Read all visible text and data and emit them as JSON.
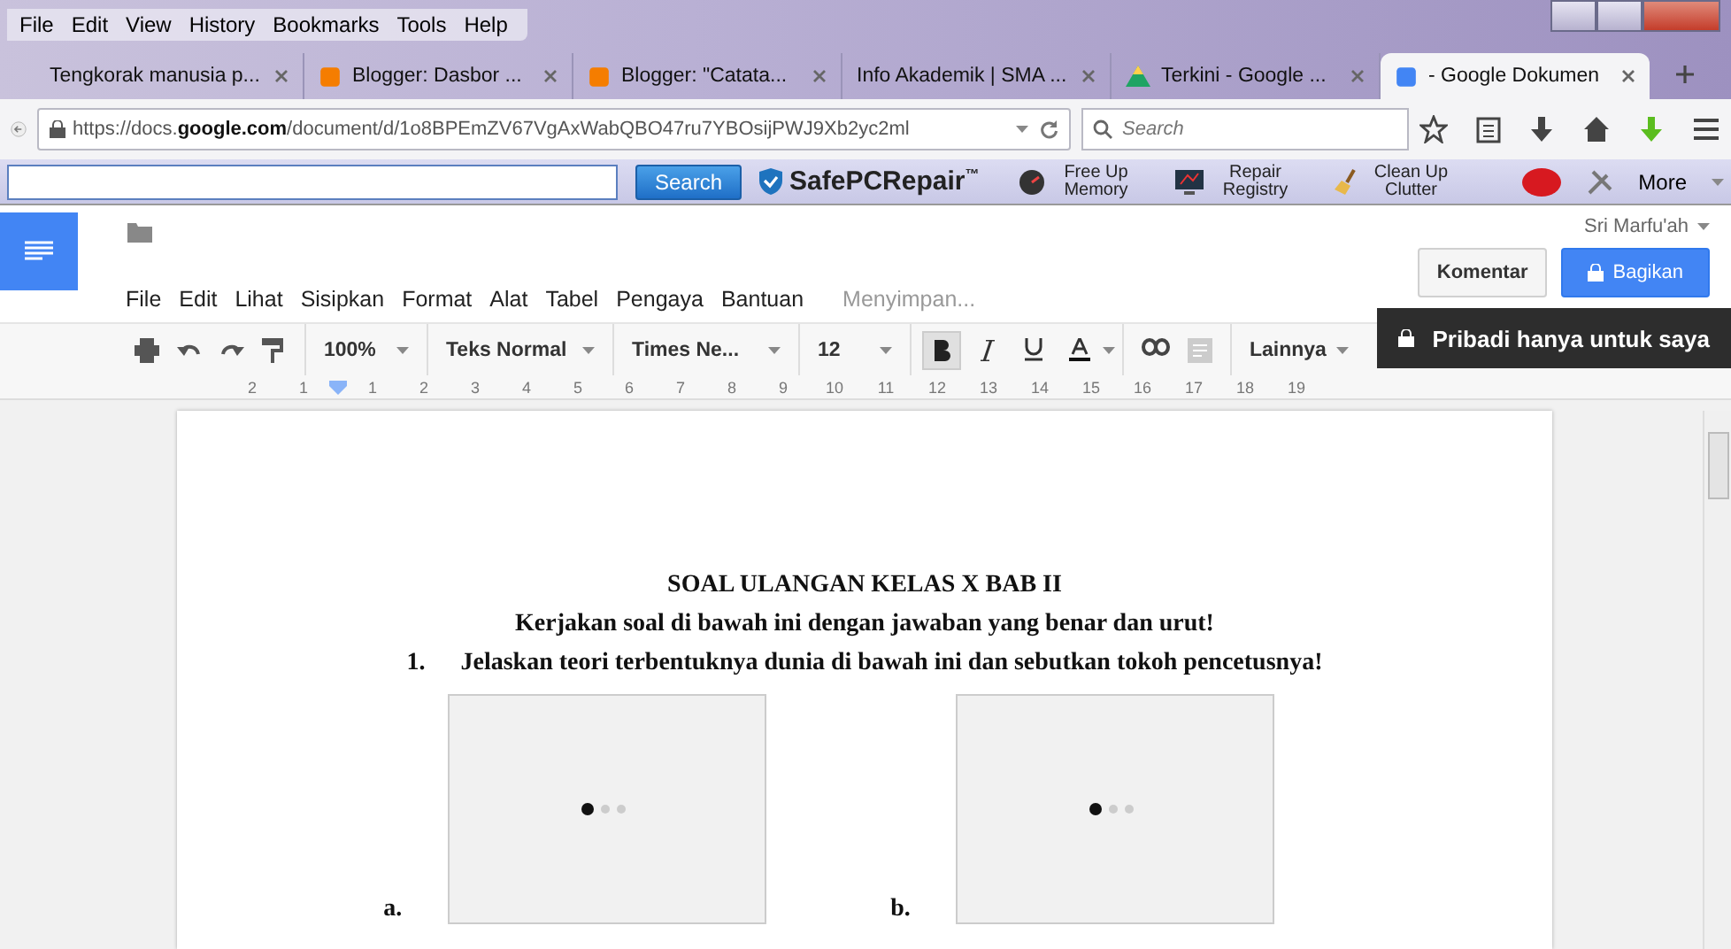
{
  "browser_menu": [
    "File",
    "Edit",
    "View",
    "History",
    "Bookmarks",
    "Tools",
    "Help"
  ],
  "tabs": [
    {
      "label": "Tengkorak manusia p...",
      "kind": "plain",
      "selected": false
    },
    {
      "label": "Blogger: Dasbor ...",
      "kind": "blogger",
      "selected": false
    },
    {
      "label": "Blogger: \"Catata...",
      "kind": "blogger",
      "selected": false
    },
    {
      "label": "Info Akademik | SMA ...",
      "kind": "plain",
      "selected": false
    },
    {
      "label": "Terkini - Google ...",
      "kind": "drive",
      "selected": false
    },
    {
      "label": "- Google Dokumen",
      "kind": "docs",
      "selected": true
    }
  ],
  "address": {
    "prefix": "https://docs.",
    "domain": "google.com",
    "path": "/document/d/1o8BPEmZV67VgAxWabQBO47ru7YBOsijPWJ9Xb2yc2ml"
  },
  "search": {
    "placeholder": "Search"
  },
  "addon_bar": {
    "search_button": "Search",
    "brand": "SafePCRepair",
    "brand_tm": "™",
    "items": [
      {
        "kind": "memory",
        "label": "Free Up Memory"
      },
      {
        "kind": "registry",
        "label": "Repair Registry"
      },
      {
        "kind": "clutter",
        "label": "Clean Up Clutter"
      }
    ],
    "more": "More"
  },
  "docs": {
    "user": "Sri Marfu'ah",
    "menu": [
      "File",
      "Edit",
      "Lihat",
      "Sisipkan",
      "Format",
      "Alat",
      "Tabel",
      "Pengaya",
      "Bantuan"
    ],
    "status": "Menyimpan...",
    "comment_button": "Komentar",
    "share_button": "Bagikan"
  },
  "toolbar": {
    "zoom": "100%",
    "style": "Teks Normal",
    "font": "Times Ne...",
    "size": "12",
    "bold": true,
    "more": "Lainnya"
  },
  "tooltip": "Pribadi hanya untuk saya",
  "ruler": [
    "2",
    "1",
    "1",
    "2",
    "3",
    "4",
    "5",
    "6",
    "7",
    "8",
    "9",
    "10",
    "11",
    "12",
    "13",
    "14",
    "15",
    "16",
    "17",
    "18",
    "19"
  ],
  "document": {
    "title": "SOAL ULANGAN KELAS X BAB II",
    "instruction": "Kerjakan soal di bawah ini dengan jawaban yang benar dan urut!",
    "question_number": "1.",
    "question": "Jelaskan teori terbentuknya dunia di bawah ini dan sebutkan tokoh pencetusnya!",
    "images": [
      {
        "label": "a."
      },
      {
        "label": "b."
      }
    ]
  }
}
